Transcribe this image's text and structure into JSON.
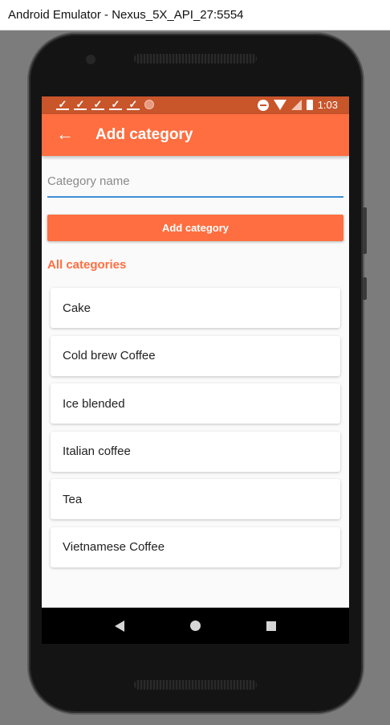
{
  "window": {
    "title": "Android Emulator - Nexus_5X_API_27:5554"
  },
  "status_bar": {
    "time": "1:03",
    "left_icons": [
      "check-download-icon",
      "check-download-icon",
      "check-download-icon",
      "check-download-icon",
      "check-download-icon",
      "circle-notification-icon"
    ],
    "right_icons": [
      "do-not-disturb-icon",
      "wifi-icon",
      "signal-icon",
      "battery-icon"
    ]
  },
  "app_bar": {
    "title": "Add category",
    "back_icon": "arrow-left-icon"
  },
  "form": {
    "input_placeholder": "Category name",
    "input_value": "",
    "add_button_label": "Add category"
  },
  "section": {
    "title": "All categories"
  },
  "categories": [
    "Cake",
    "Cold brew Coffee",
    "Ice blended",
    "Italian coffee",
    "Tea",
    "Vietnamese Coffee"
  ],
  "colors": {
    "accent": "#ff6e40",
    "status_bar": "#c9552b",
    "input_underline": "#3d8ed6",
    "background": "#fafafa"
  },
  "nav_bar": {
    "icons": [
      "back-triangle-icon",
      "home-circle-icon",
      "recents-square-icon"
    ]
  }
}
